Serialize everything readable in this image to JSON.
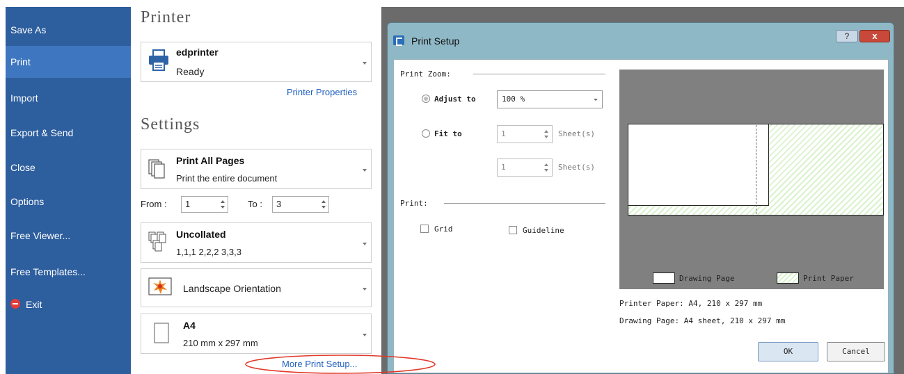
{
  "sidebar": {
    "items": [
      {
        "label": "Save As"
      },
      {
        "label": "Print"
      },
      {
        "label": "Import"
      },
      {
        "label": "Export & Send"
      },
      {
        "label": "Close"
      },
      {
        "label": "Options"
      },
      {
        "label": "Free Viewer..."
      },
      {
        "label": "Free Templates..."
      },
      {
        "label": "Exit"
      }
    ],
    "active": "Print"
  },
  "printer_section": {
    "title": "Printer",
    "printer_name": "edprinter",
    "printer_status": "Ready",
    "properties_link": "Printer Properties"
  },
  "settings_section": {
    "title": "Settings",
    "pages": {
      "title": "Print All Pages",
      "subtitle": "Print the entire document"
    },
    "range": {
      "from_label": "From :",
      "from_value": "1",
      "to_label": "To :",
      "to_value": "3"
    },
    "collation": {
      "title": "Uncollated",
      "subtitle": "1,1,1  2,2,2  3,3,3"
    },
    "orientation": {
      "title": "Landscape Orientation"
    },
    "paper": {
      "title": "A4",
      "subtitle": "210 mm x 297 mm"
    },
    "more_link": "More Print Setup..."
  },
  "dialog": {
    "title": "Print Setup",
    "help_label": "?",
    "close_label": "x",
    "zoom_group_label": "Print Zoom:",
    "adjust_label": "Adjust to",
    "adjust_value": "100 %",
    "fit_label": "Fit to",
    "fit_value_1": "1",
    "fit_value_2": "1",
    "sheets_label": "Sheet(s)",
    "print_group_label": "Print:",
    "grid_label": "Grid",
    "guideline_label": "Guideline",
    "legend_drawing": "Drawing Page",
    "legend_paper": "Print Paper",
    "info_paper": "Printer Paper: A4, 210 x 297 mm",
    "info_drawing": "Drawing Page: A4 sheet, 210 x 297 mm",
    "ok_label": "OK",
    "cancel_label": "Cancel",
    "adjust_checked": true,
    "fit_checked": false,
    "grid_checked": false,
    "guideline_checked": false
  },
  "colors": {
    "sidebar": "#2d5e9e",
    "sidebar_active": "#3f76c0",
    "link": "#1f5fbf",
    "annotation": "#e03a2a",
    "print_paper_hatch": "#d9f2cc"
  }
}
